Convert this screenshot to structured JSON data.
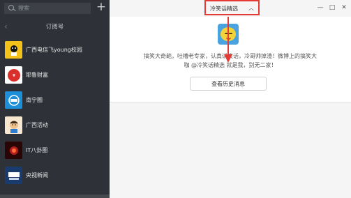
{
  "sidebar": {
    "search_placeholder": "搜索",
    "add_label": "+",
    "back_glyph": "‹",
    "header_title": "订阅号",
    "items": [
      {
        "label": "广西电信飞young校园",
        "color": "#f2c21b",
        "icon_text": ""
      },
      {
        "label": "耶鲁财富",
        "color": "#d9302c",
        "icon_text": "耶鲁财富"
      },
      {
        "label": "南宁圈",
        "color": "#1d8fd8",
        "icon_text": "南宁圈"
      },
      {
        "label": "广西活动",
        "color": "#f0c08a",
        "icon_text": ""
      },
      {
        "label": "IT八卦圈",
        "color": "#7a1010",
        "icon_text": ""
      },
      {
        "label": "央视新闻",
        "color": "#1a3b6e",
        "icon_text": "央视新闻"
      }
    ]
  },
  "main": {
    "title": "冷笑话精选",
    "chevron": "︿",
    "window_buttons": {
      "minimize": "—",
      "maximize": "□",
      "close": "✕"
    },
    "description_line1": "搞笑大奇葩，吐槽老专家，认真讲笑话，冷哥帅掉渣！微博上的搞笑大",
    "description_line2": "咖 @冷笑话精选 就是我，别无二家！",
    "history_button": "查看历史消息"
  },
  "colors": {
    "sidebar_bg": "#2e3238",
    "highlight_red": "#e53935"
  }
}
